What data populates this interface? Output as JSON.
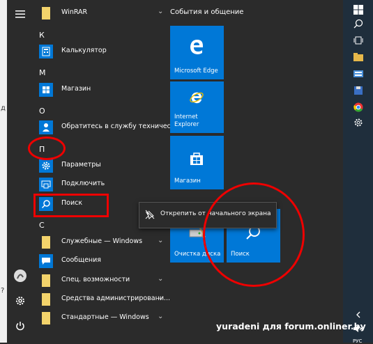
{
  "rail": {
    "hamburger_icon": "menu-icon",
    "settings_icon": "gear-icon",
    "power_icon": "power-icon"
  },
  "applist": {
    "items": [
      {
        "type": "app",
        "label": "WinRAR",
        "icon": "folder-icon",
        "chevron": true
      },
      {
        "type": "letter",
        "label": "К"
      },
      {
        "type": "app",
        "label": "Калькулятор",
        "icon": "calculator-icon"
      },
      {
        "type": "letter",
        "label": "М"
      },
      {
        "type": "app",
        "label": "Магазин",
        "icon": "store-icon"
      },
      {
        "type": "letter",
        "label": "О"
      },
      {
        "type": "app",
        "label": "Обратитесь в службу техническо...",
        "icon": "person-icon"
      },
      {
        "type": "letter",
        "label": "П"
      },
      {
        "type": "app",
        "label": "Параметры",
        "icon": "gear-icon"
      },
      {
        "type": "app",
        "label": "Подключить",
        "icon": "connect-icon"
      },
      {
        "type": "app",
        "label": "Поиск",
        "icon": "search-icon"
      },
      {
        "type": "letter",
        "label": "С"
      },
      {
        "type": "app",
        "label": "Служебные — Windows",
        "icon": "folder-icon",
        "chevron": true
      },
      {
        "type": "app",
        "label": "Сообщения",
        "icon": "message-icon"
      },
      {
        "type": "app",
        "label": "Спец. возможности",
        "icon": "folder-icon",
        "chevron": true
      },
      {
        "type": "app",
        "label": "Средства администрировани...",
        "icon": "folder-icon",
        "chevron": true
      },
      {
        "type": "app",
        "label": "Стандартные — Windows",
        "icon": "folder-icon",
        "chevron": true
      }
    ]
  },
  "tiles": {
    "group_title": "События и общение",
    "edge": "Microsoft Edge",
    "ie_line1": "Internet",
    "ie_line2": "Explorer",
    "store": "Магазин",
    "cleanup": "Очистка диска",
    "search": "Поиск"
  },
  "context_menu": {
    "unpin": "Открепить от начального экрана"
  },
  "taskbar": {
    "icons": [
      "windows-icon",
      "search-icon",
      "task-view-icon",
      "file-explorer-icon",
      "keyboard-icon",
      "floppy-icon",
      "chrome-icon",
      "gear-icon",
      "chevron-up-icon",
      "speaker-mute-icon"
    ],
    "lang": "РУС"
  },
  "watermark": "yuradeni для forum.onliner.by",
  "colors": {
    "accent": "#0078d7",
    "annotation": "#e00000",
    "menu_bg": "#2b2b2b",
    "taskbar": "#1f2e3c"
  }
}
